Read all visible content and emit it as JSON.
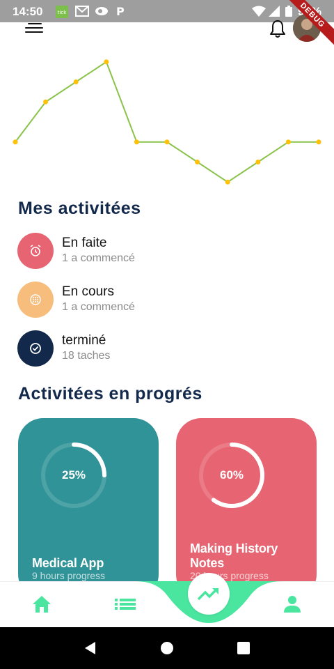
{
  "status_bar": {
    "time": "14:50",
    "battery": "99%"
  },
  "debug_banner": "DEBUG",
  "chart_data": {
    "type": "line",
    "x": [
      0,
      1,
      2,
      3,
      4,
      5,
      6,
      7,
      8,
      9,
      10
    ],
    "values": [
      4,
      6,
      7,
      8,
      4,
      4,
      3,
      2,
      3,
      4,
      4
    ],
    "ylim": [
      1,
      9
    ],
    "line_color": "#8bc34a",
    "point_color": "#ffc107",
    "grid": false
  },
  "activities": {
    "title": "Mes activitées",
    "items": [
      {
        "name": "En faite",
        "sub": "1 a commencé",
        "color": "#e76472",
        "icon": "alarm-icon"
      },
      {
        "name": "En cours",
        "sub": "1 a commencé",
        "color": "#f7bd7d",
        "icon": "blur-icon"
      },
      {
        "name": "terminé",
        "sub": "18 taches",
        "color": "#13294b",
        "icon": "check-circle-icon"
      }
    ]
  },
  "progress": {
    "title": "Activitées en progrés",
    "cards": [
      {
        "title": "Medical App",
        "sub": "9 hours progress",
        "percent_label": "25%",
        "percent": 25,
        "color": "#309397"
      },
      {
        "title": "Making History Notes",
        "sub": "20 hours progress",
        "percent_label": "60%",
        "percent": 60,
        "color": "#e76472"
      }
    ]
  },
  "colors": {
    "accent": "#4ae6a0",
    "dark": "#13294b"
  }
}
